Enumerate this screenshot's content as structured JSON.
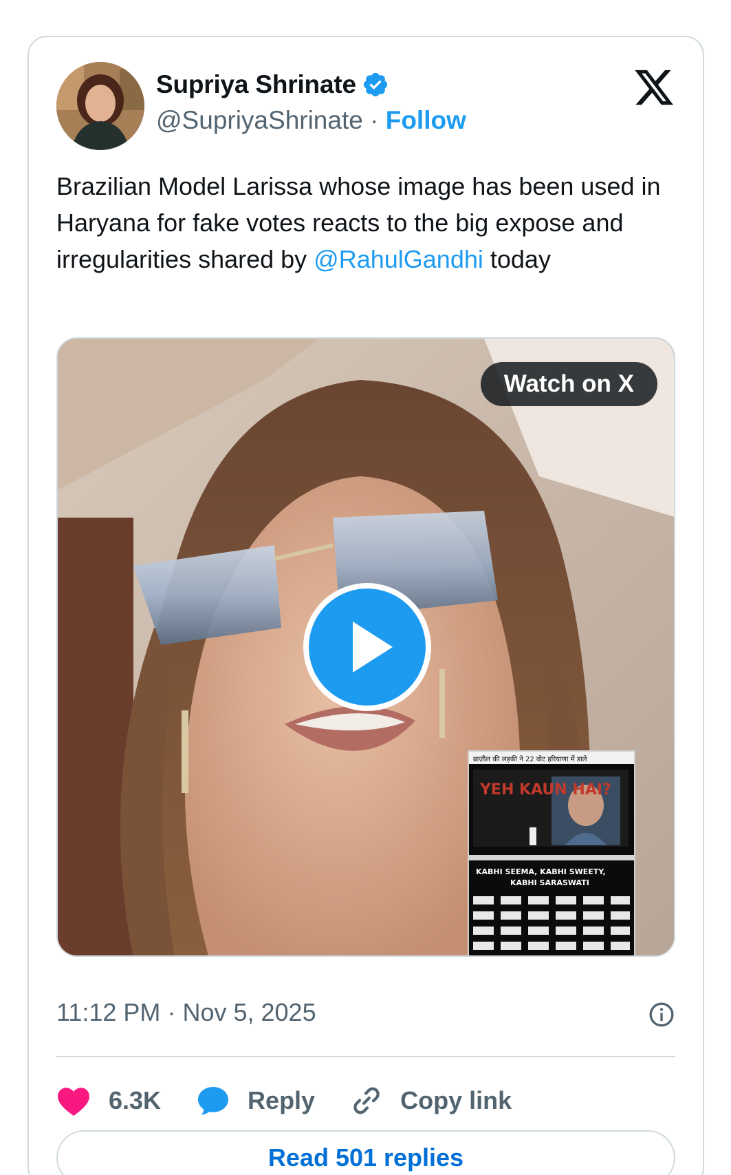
{
  "author": {
    "display_name": "Supriya Shrinate",
    "handle": "@SupriyaShrinate",
    "separator": "·",
    "follow_label": "Follow",
    "verified_icon": "verified-badge-icon"
  },
  "brand": {
    "logo_icon": "x-logo-icon"
  },
  "tweet": {
    "text_before_mention": "Brazilian Model Larissa whose image has been used in Haryana for fake votes reacts to the big expose and irregularities shared by ",
    "mention": "@RahulGandhi",
    "text_after_mention": " today"
  },
  "media": {
    "watch_label": "Watch on X",
    "play_icon": "play-icon",
    "inset_screen_text": "YEH KAUN HAI?",
    "inset_caption_1": "KABHI SEEMA, KABHI SWEETY,",
    "inset_caption_2": "KABHI SARASWATI",
    "inset_header": "ब्राज़ील की लड़की ने 22 वोट हरियाणा में डाले"
  },
  "meta": {
    "time": "11:12 PM",
    "separator": "·",
    "date": "Nov 5, 2025",
    "info_icon": "info-icon"
  },
  "actions": {
    "like_count": "6.3K",
    "reply_label": "Reply",
    "copy_label": "Copy link"
  },
  "read_replies_label": "Read 501 replies",
  "colors": {
    "accent": "#1d9bf0",
    "like": "#f91880",
    "muted": "#536471",
    "text": "#0f1419",
    "border": "#cfd9de"
  }
}
